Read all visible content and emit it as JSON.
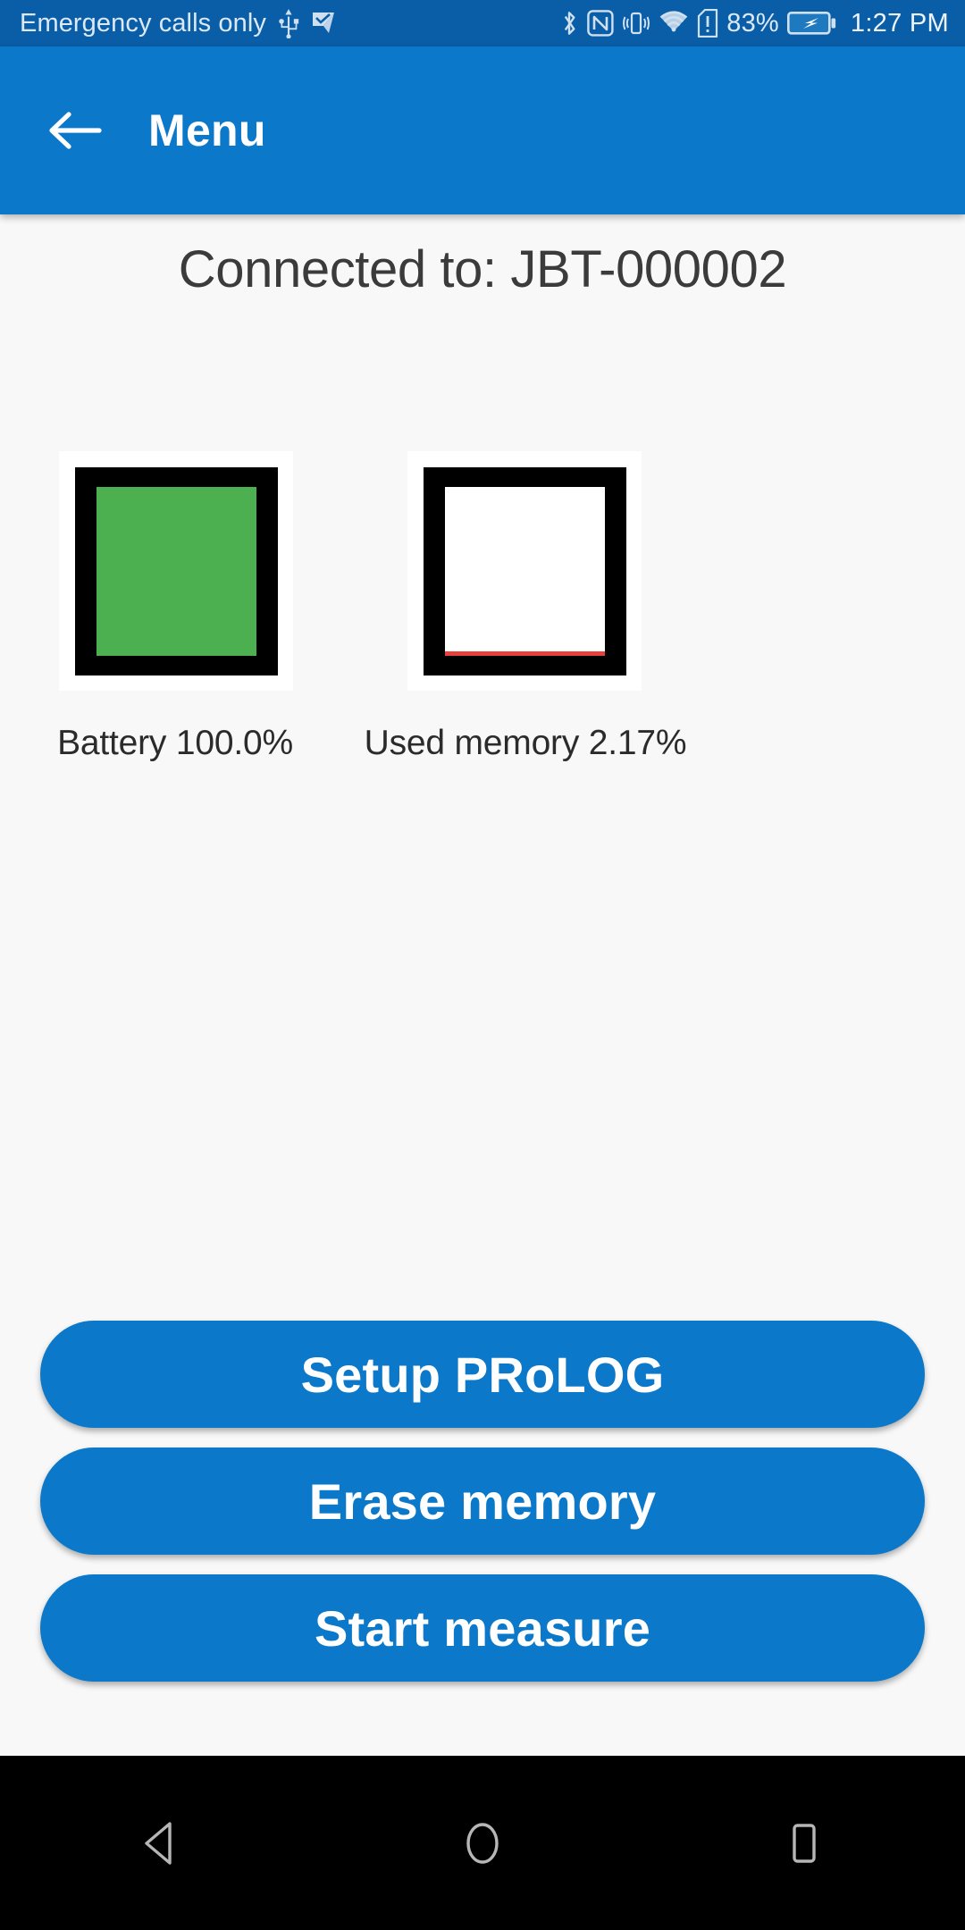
{
  "status_bar": {
    "carrier": "Emergency calls only",
    "battery_percent": "83%",
    "time": "1:27 PM",
    "icons": [
      "usb-icon",
      "vpn-key-icon",
      "bluetooth-icon",
      "nfc-icon",
      "vibrate-icon",
      "wifi-icon",
      "sim-alert-icon",
      "battery-charging-icon"
    ]
  },
  "app_bar": {
    "title": "Menu",
    "back_icon": "arrow-left-icon",
    "color": "#0b78c9"
  },
  "main": {
    "connection_status": "Connected to: JBT-000002",
    "gauges": [
      {
        "id": "battery",
        "label": "Battery 100.0%",
        "value": 100.0,
        "fill_color": "#4caf50",
        "track_color": "#ffffff",
        "frame_color": "#000000"
      },
      {
        "id": "memory",
        "label": "Used memory 2.17%",
        "value": 2.17,
        "fill_color": "#e8403a",
        "track_color": "#ffffff",
        "frame_color": "#000000"
      }
    ],
    "buttons": [
      {
        "id": "setup-prolog",
        "label": "Setup PRoLOG"
      },
      {
        "id": "erase-memory",
        "label": "Erase memory"
      },
      {
        "id": "start-measure",
        "label": "Start measure"
      }
    ]
  },
  "nav_bar": {
    "back": "nav-back-icon",
    "home": "nav-home-icon",
    "recents": "nav-recents-icon"
  }
}
